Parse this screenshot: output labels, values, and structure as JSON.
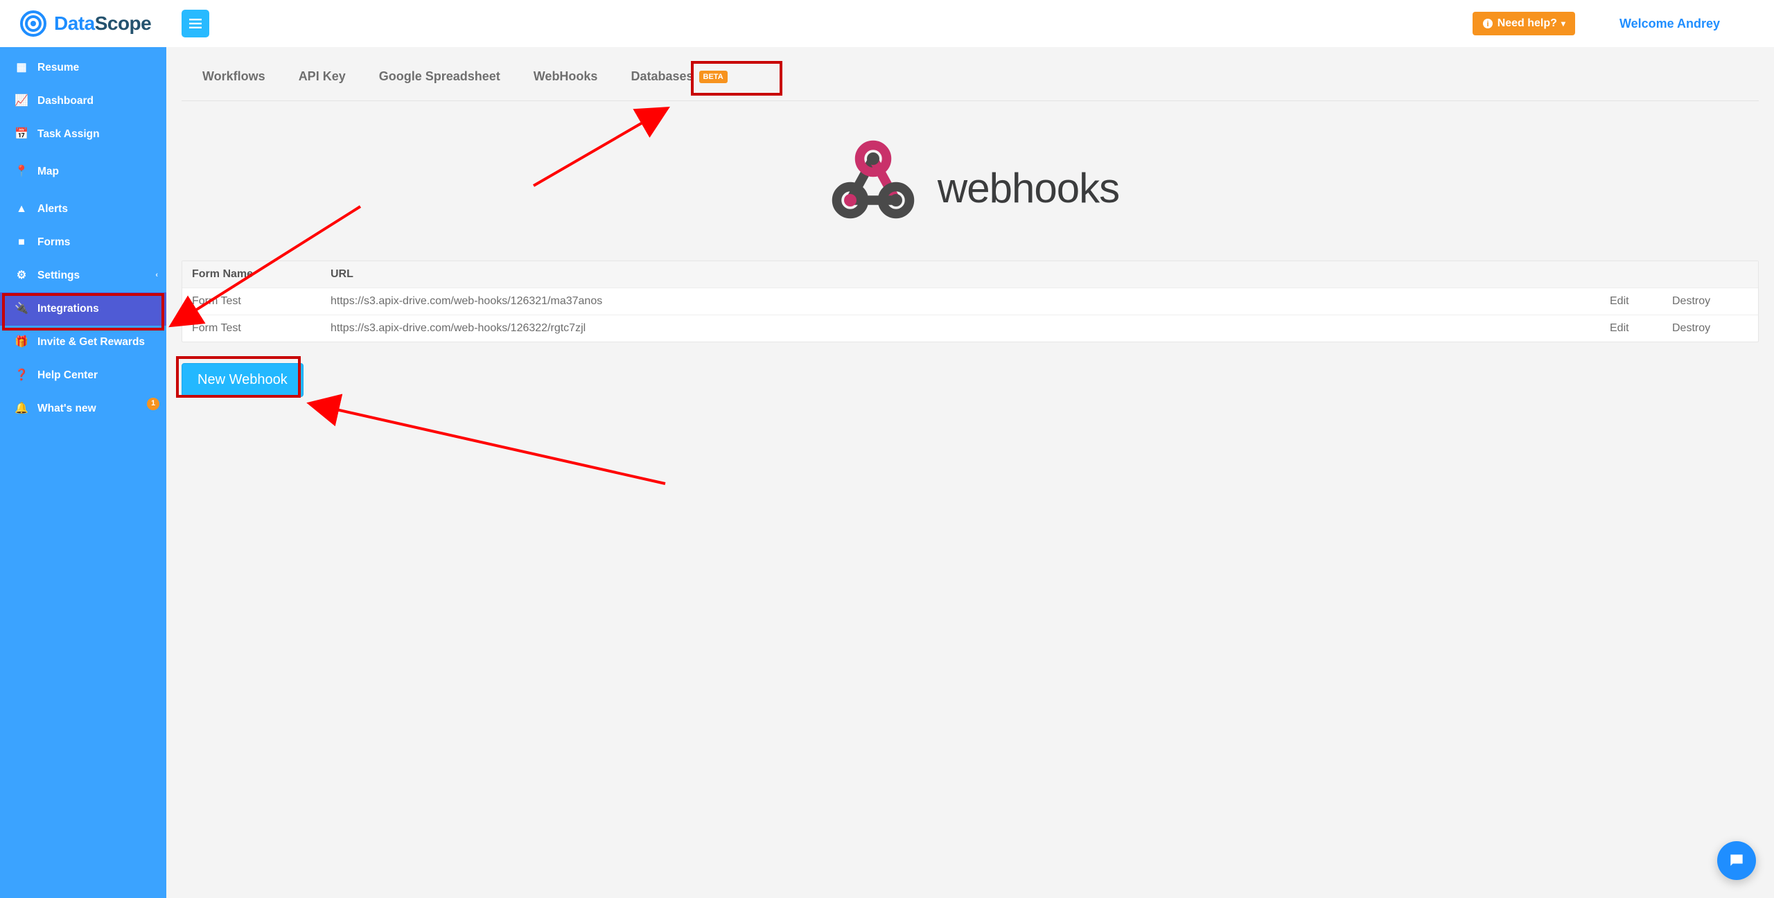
{
  "brand": {
    "part1": "Data",
    "part2": "Scope"
  },
  "header": {
    "help_label": "Need help?",
    "welcome": "Welcome Andrey"
  },
  "sidebar": {
    "items": [
      {
        "label": "Resume",
        "icon": "grid-icon"
      },
      {
        "label": "Dashboard",
        "icon": "chart-icon"
      },
      {
        "label": "Task Assign",
        "icon": "calendar-icon"
      },
      {
        "label": "Map",
        "icon": "pin-icon"
      },
      {
        "label": "Alerts",
        "icon": "warning-icon"
      },
      {
        "label": "Forms",
        "icon": "archive-icon"
      },
      {
        "label": "Settings",
        "icon": "gear-icon",
        "chevron": true
      },
      {
        "label": "Integrations",
        "icon": "plug-icon",
        "active": true
      },
      {
        "label": "Invite & Get Rewards",
        "icon": "gift-icon",
        "multiline": true
      },
      {
        "label": "Help Center",
        "icon": "help-icon"
      },
      {
        "label": "What's new",
        "icon": "bell-icon",
        "badge": "1"
      }
    ]
  },
  "tabs": [
    {
      "label": "Workflows"
    },
    {
      "label": "API Key"
    },
    {
      "label": "Google Spreadsheet"
    },
    {
      "label": "WebHooks",
      "highlighted": true
    },
    {
      "label": "Databases",
      "beta": true
    }
  ],
  "beta_badge": "BETA",
  "hero_label": "webhooks",
  "table": {
    "headers": {
      "form": "Form Name",
      "url": "URL"
    },
    "actions": {
      "edit": "Edit",
      "destroy": "Destroy"
    },
    "rows": [
      {
        "form": "Form Test",
        "url": "https://s3.apix-drive.com/web-hooks/126321/ma37anos"
      },
      {
        "form": "Form Test",
        "url": "https://s3.apix-drive.com/web-hooks/126322/rgtc7zjl"
      }
    ]
  },
  "new_webhook_label": "New Webhook"
}
